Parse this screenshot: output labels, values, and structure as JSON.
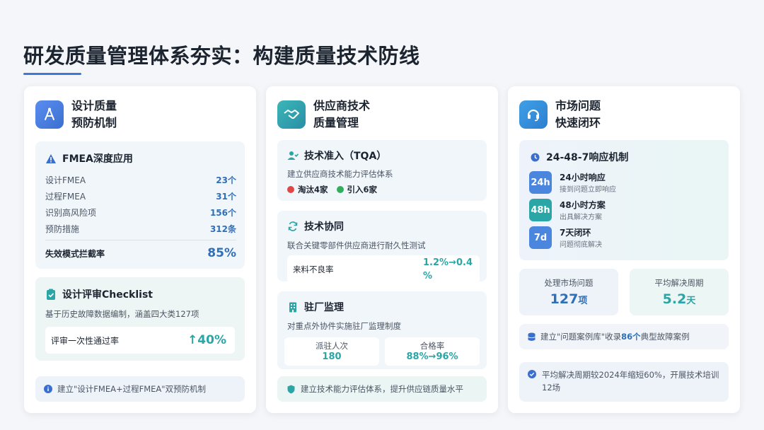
{
  "page": {
    "title": "研发质量管理体系夯实：构建质量技术防线"
  },
  "col1": {
    "title_line1": "设计质量",
    "title_line2": "预防机制",
    "fmea": {
      "heading": "FMEA深度应用",
      "rows": [
        {
          "label": "设计FMEA",
          "value": "23个"
        },
        {
          "label": "过程FMEA",
          "value": "31个"
        },
        {
          "label": "识别高风险项",
          "value": "156个"
        },
        {
          "label": "预防措施",
          "value": "312条"
        }
      ],
      "rate_label": "失效模式拦截率",
      "rate_value": "85%"
    },
    "checklist": {
      "heading": "设计评审Checklist",
      "desc": "基于历史故障数据编制，涵盖四大类127项",
      "pass_label": "评审一次性通过率",
      "pass_value": "↑40%"
    },
    "note": "建立\"设计FMEA+过程FMEA\"双预防机制"
  },
  "col2": {
    "title_line1": "供应商技术",
    "title_line2": "质量管理",
    "tqa": {
      "heading": "技术准入（TQA）",
      "desc": "建立供应商技术能力评估体系",
      "out": "淘汰4家",
      "in": "引入6家"
    },
    "collab": {
      "heading": "技术协同",
      "desc": "联合关键零部件供应商进行耐久性测试",
      "defect_label": "来料不良率",
      "defect_value_1": "1.2%→0.4",
      "defect_value_2": "%"
    },
    "onsite": {
      "heading": "驻厂监理",
      "desc": "对重点外协件实施驻厂监理制度",
      "stat1_label": "派驻人次",
      "stat1_value": "180",
      "stat2_label": "合格率",
      "stat2_value": "88%→96%"
    },
    "note": "建立技术能力评估体系，提升供应链质量水平"
  },
  "col3": {
    "title_line1": "市场问题",
    "title_line2": "快速闭环",
    "mech": {
      "heading": "24-48-7响应机制",
      "items": [
        {
          "badge": "24h",
          "title": "24小时响应",
          "desc": "接到问题立即响应"
        },
        {
          "badge": "48h",
          "title": "48小时方案",
          "desc": "出具解决方案"
        },
        {
          "badge": "7d",
          "title": "7天闭环",
          "desc": "问题彻底解决"
        }
      ]
    },
    "stats": [
      {
        "label": "处理市场问题",
        "value": "127",
        "unit": "项"
      },
      {
        "label": "平均解决周期",
        "value": "5.2",
        "unit": "天"
      }
    ],
    "library": {
      "prefix": "建立\"问题案例库\"收录",
      "count": "86个",
      "suffix": "典型故障案例"
    },
    "note_line1": "平均解决周期较2024年缩短60%，开展技术培训",
    "note_line2": "12场"
  },
  "colors": {
    "accent": "#3a7bd5",
    "teal": "#2aa6a6",
    "value_blue": "#2f6fba"
  }
}
